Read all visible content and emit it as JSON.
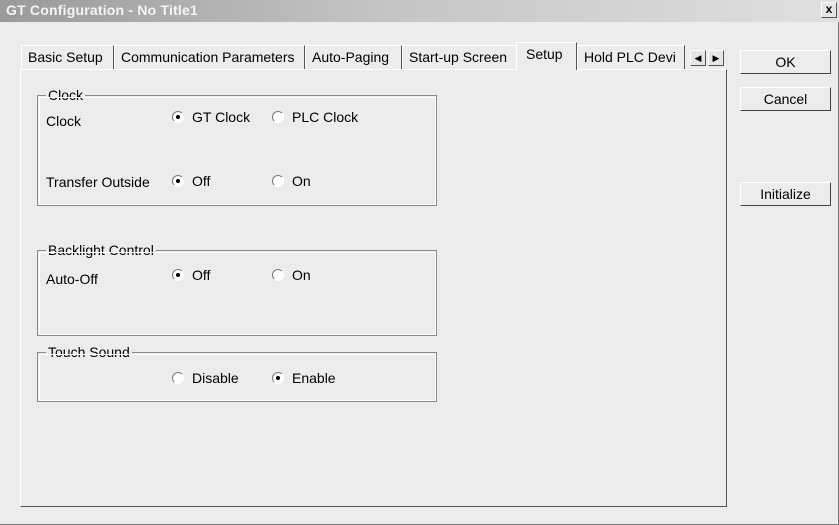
{
  "window": {
    "title": "GT Configuration - No Title1",
    "close_label": "x"
  },
  "tabs": [
    {
      "label": "Basic Setup"
    },
    {
      "label": "Communication Parameters"
    },
    {
      "label": "Auto-Paging"
    },
    {
      "label": "Start-up Screen"
    },
    {
      "label": "Setup",
      "active": true
    },
    {
      "label": "Hold PLC Devi"
    }
  ],
  "tab_scroll": {
    "left": "◀",
    "right": "▶"
  },
  "clock_group": {
    "title": "Clock",
    "clock_label": "Clock",
    "gt_clock": "GT Clock",
    "plc_clock": "PLC Clock",
    "clock_selected": "GT Clock",
    "transfer_label": "Transfer Outside",
    "transfer_off": "Off",
    "transfer_on": "On",
    "transfer_selected": "Off"
  },
  "backlight_group": {
    "title": "Backlight Control",
    "auto_off_label": "Auto-Off",
    "off": "Off",
    "on": "On",
    "selected": "Off"
  },
  "touch_group": {
    "title": "Touch Sound",
    "disable": "Disable",
    "enable": "Enable",
    "selected": "Enable"
  },
  "buttons": {
    "ok": "OK",
    "cancel": "Cancel",
    "initialize": "Initialize"
  }
}
